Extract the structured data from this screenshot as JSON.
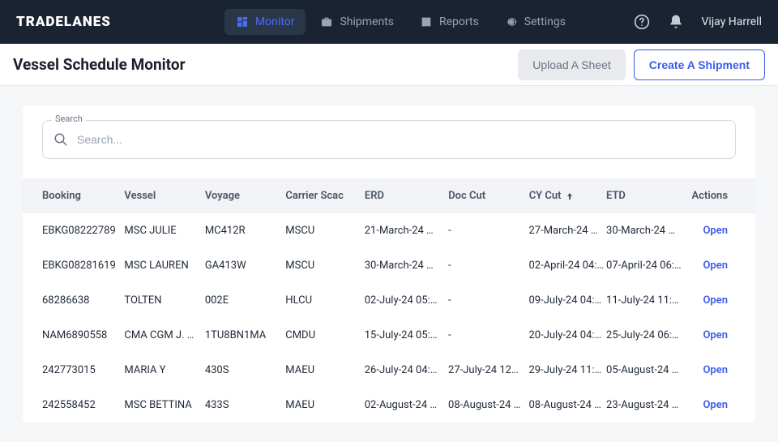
{
  "brand": "TRADELANES",
  "nav": {
    "monitor": "Monitor",
    "shipments": "Shipments",
    "reports": "Reports",
    "settings": "Settings"
  },
  "user": {
    "name": "Vijay Harrell"
  },
  "page": {
    "title": "Vessel Schedule Monitor",
    "upload_label": "Upload A Sheet",
    "create_label": "Create A Shipment"
  },
  "search": {
    "label": "Search",
    "placeholder": "Search..."
  },
  "table": {
    "headers": {
      "booking": "Booking",
      "vessel": "Vessel",
      "voyage": "Voyage",
      "carrier": "Carrier Scac",
      "erd": "ERD",
      "doccut": "Doc Cut",
      "cycut": "CY Cut",
      "etd": "ETD",
      "actions": "Actions"
    },
    "open_label": "Open",
    "rows": [
      {
        "booking": "EBKG08222789",
        "vessel": "MSC JULIE",
        "voyage": "MC412R",
        "carrier": "MSCU",
        "erd": "21-March-24 …",
        "doccut": "-",
        "cycut": "27-March-24 …",
        "etd": "30-March-24 …"
      },
      {
        "booking": "EBKG08281619",
        "vessel": "MSC LAUREN",
        "voyage": "GA413W",
        "carrier": "MSCU",
        "erd": "30-March-24 …",
        "doccut": "-",
        "cycut": "02-April-24 04:…",
        "etd": "07-April-24 06:…"
      },
      {
        "booking": "68286638",
        "vessel": "TOLTEN",
        "voyage": "002E",
        "carrier": "HLCU",
        "erd": "02-July-24 05:…",
        "doccut": "-",
        "cycut": "09-July-24 04:…",
        "etd": "11-July-24 11:…"
      },
      {
        "booking": "NAM6890558",
        "vessel": "CMA CGM J. …",
        "voyage": "1TU8BN1MA",
        "carrier": "CMDU",
        "erd": "15-July-24 05:…",
        "doccut": "-",
        "cycut": "20-July-24 04:…",
        "etd": "25-July-24 06:…"
      },
      {
        "booking": "242773015",
        "vessel": "MARIA Y",
        "voyage": "430S",
        "carrier": "MAEU",
        "erd": "26-July-24 04:…",
        "doccut": "27-July-24 12:…",
        "cycut": "29-July-24 11:…",
        "etd": "05-August-24 …"
      },
      {
        "booking": "242558452",
        "vessel": "MSC BETTINA",
        "voyage": "433S",
        "carrier": "MAEU",
        "erd": "02-August-24 …",
        "doccut": "08-August-24 …",
        "cycut": "08-August-24 …",
        "etd": "23-August-24 …"
      }
    ]
  }
}
